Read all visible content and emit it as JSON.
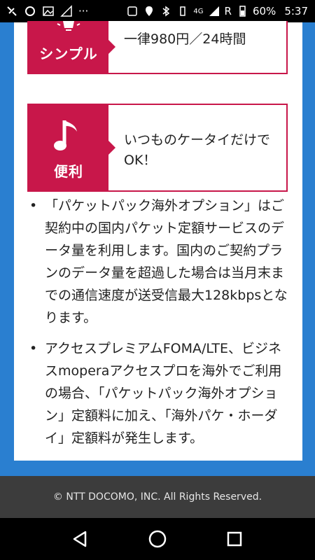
{
  "status_bar": {
    "network": "4G",
    "signal_letter": "R",
    "battery": "60%",
    "time": "5:37"
  },
  "features": [
    {
      "badge": "シンプル",
      "icon": "lightbulb-icon",
      "desc": "一律980円／24時間"
    },
    {
      "badge": "便利",
      "icon": "music-note-icon",
      "desc": "いつものケータイだけでOK！"
    }
  ],
  "notes": [
    {
      "text": "「パケットパック海外オプション」はご契約中の国内パケット定額サービスのデータ量を利用します。国内のご契約プランのデータ量を超過した場合は当月末までの通信速度が送受信最大128kbpsとなります。"
    },
    {
      "text": "アクセスプレミアムFOMA/LTE、ビジネスmoperaアクセスプロを海外でご利用の場合、「パケットパック海外オプション」定額料に加え、「海外パケ・ホーダイ」定額料が発生します。"
    }
  ],
  "bullet": "•",
  "footer": {
    "copyright": "© NTT DOCOMO, INC. All Rights Reserved."
  },
  "colors": {
    "accent": "#c8174a",
    "background": "#2a7fd0",
    "footer": "#3c3c3c"
  }
}
